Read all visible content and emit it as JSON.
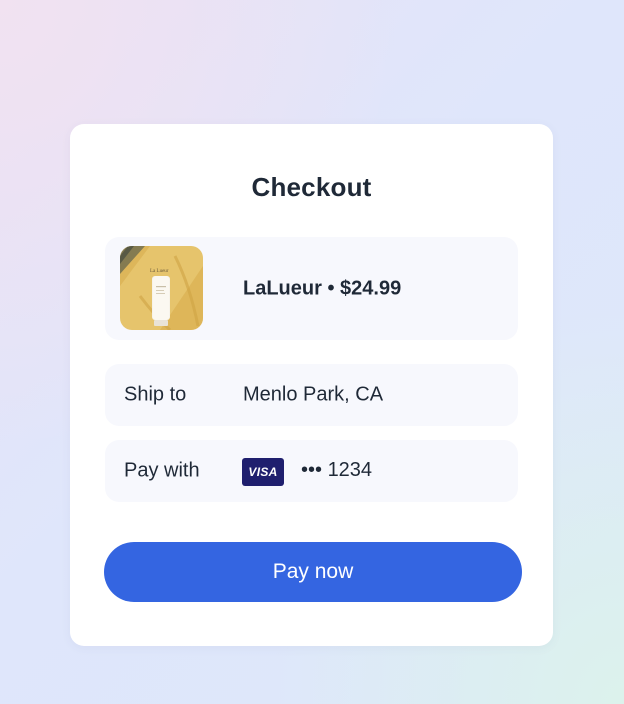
{
  "checkout": {
    "title": "Checkout",
    "product": {
      "brand": "LaLueur",
      "separator": "•",
      "price": "$24.99",
      "thumbnail_icon": "product-tube-image"
    },
    "shipping": {
      "label": "Ship to",
      "value": "Menlo Park, CA"
    },
    "payment": {
      "label": "Pay with",
      "card_brand": "VISA",
      "masked_number": "••• 1234"
    },
    "pay_button_label": "Pay now"
  },
  "colors": {
    "accent": "#3465e1",
    "card_bg": "#ffffff",
    "row_bg": "#f7f8fd",
    "text": "#1f2937",
    "visa_bg": "#1f1f6e"
  }
}
